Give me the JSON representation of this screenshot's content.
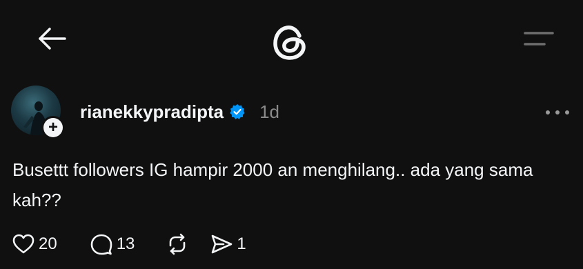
{
  "icons": {
    "back": "back-arrow-icon",
    "logo": "threads-logo-icon",
    "menu": "menu-icon",
    "more": "more-options-icon",
    "verified": "verified-badge-icon",
    "like": "heart-icon",
    "reply": "comment-icon",
    "repost": "repost-icon",
    "share": "share-icon",
    "follow": "plus-icon"
  },
  "colors": {
    "background": "#101010",
    "text": "#f3f5f7",
    "muted": "#8a8a8a",
    "verified": "#0095f6"
  },
  "post": {
    "username": "rianekkypradipta",
    "time": "1d",
    "text": "Busettt followers IG hampir 2000 an menghilang.. ada yang sama kah??",
    "likes": "20",
    "replies": "13",
    "shares": "1",
    "follow_symbol": "+"
  }
}
